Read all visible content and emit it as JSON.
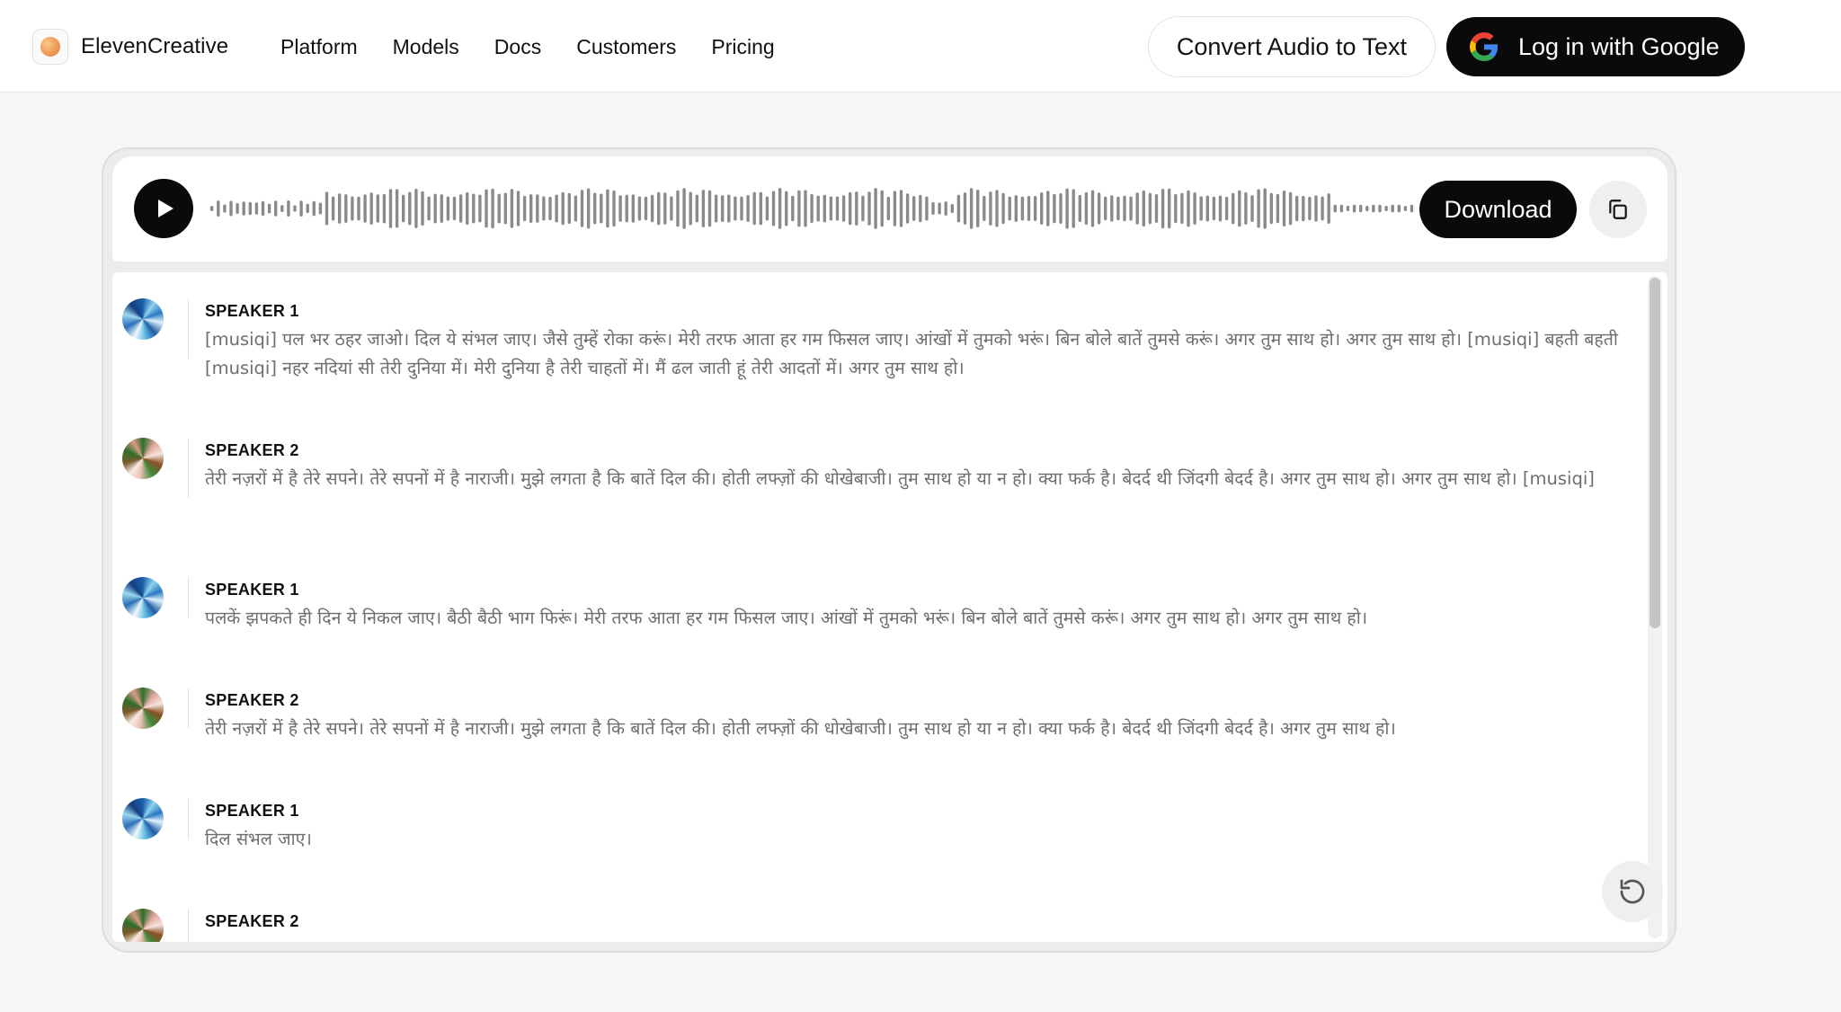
{
  "header": {
    "brand_name": "ElevenCreative",
    "nav": [
      {
        "label": "Platform"
      },
      {
        "label": "Models"
      },
      {
        "label": "Docs"
      },
      {
        "label": "Customers"
      },
      {
        "label": "Pricing"
      }
    ],
    "convert_label": "Convert Audio to Text",
    "login_label": "Log in with Google"
  },
  "player": {
    "download_label": "Download",
    "icons": {
      "play": "play-icon",
      "copy": "copy-icon",
      "restart": "restart-icon"
    }
  },
  "transcript": [
    {
      "speaker": "SPEAKER 1",
      "avatar": "speaker-1",
      "text": "[musiqi] पल भर ठहर जाओ। दिल ये संभल जाए। जैसे तुम्हें रोका करूं। मेरी तरफ आता हर गम फिसल जाए। आंखों में तुमको भरूं। बिन बोले बातें तुमसे करूं। अगर तुम साथ हो। अगर तुम साथ हो। [musiqi] बहती बहती [musiqi] नहर नदियां सी तेरी दुनिया में। मेरी दुनिया है तेरी चाहतों में। मैं ढल जाती हूं तेरी आदतों में। अगर तुम साथ हो।"
    },
    {
      "speaker": "SPEAKER 2",
      "avatar": "speaker-2",
      "text": "तेरी नज़रों में है तेरे सपने। तेरे सपनों में है नाराजी। मुझे लगता है कि बातें दिल की। होती लफ्ज़ों की धोखेबाजी। तुम साथ हो या न हो। क्या फर्क है। बेदर्द थी जिंदगी बेदर्द है। अगर तुम साथ हो। अगर तुम साथ हो। [musiqi]"
    },
    {
      "speaker": "SPEAKER 1",
      "avatar": "speaker-1",
      "text": "पलकें झपकते ही दिन ये निकल जाए। बैठी बैठी भाग फिरूं। मेरी तरफ आता हर गम फिसल जाए। आंखों में तुमको भरूं। बिन बोले बातें तुमसे करूं। अगर तुम साथ हो। अगर तुम साथ हो।"
    },
    {
      "speaker": "SPEAKER 2",
      "avatar": "speaker-2",
      "text": "तेरी नज़रों में है तेरे सपने। तेरे सपनों में है नाराजी। मुझे लगता है कि बातें दिल की। होती लफ्ज़ों की धोखेबाजी। तुम साथ हो या न हो। क्या फर्क है। बेदर्द थी जिंदगी बेदर्द है। अगर तुम साथ हो।"
    },
    {
      "speaker": "SPEAKER 1",
      "avatar": "speaker-1",
      "text": "दिल संभल जाए।"
    },
    {
      "speaker": "SPEAKER 2",
      "avatar": "speaker-2",
      "text": ""
    }
  ],
  "colors": {
    "primary": "#0a0a0a",
    "page_background": "#f6f6f6",
    "waveform": "#8a8a8a",
    "transcript_text": "#6e6e6e"
  }
}
